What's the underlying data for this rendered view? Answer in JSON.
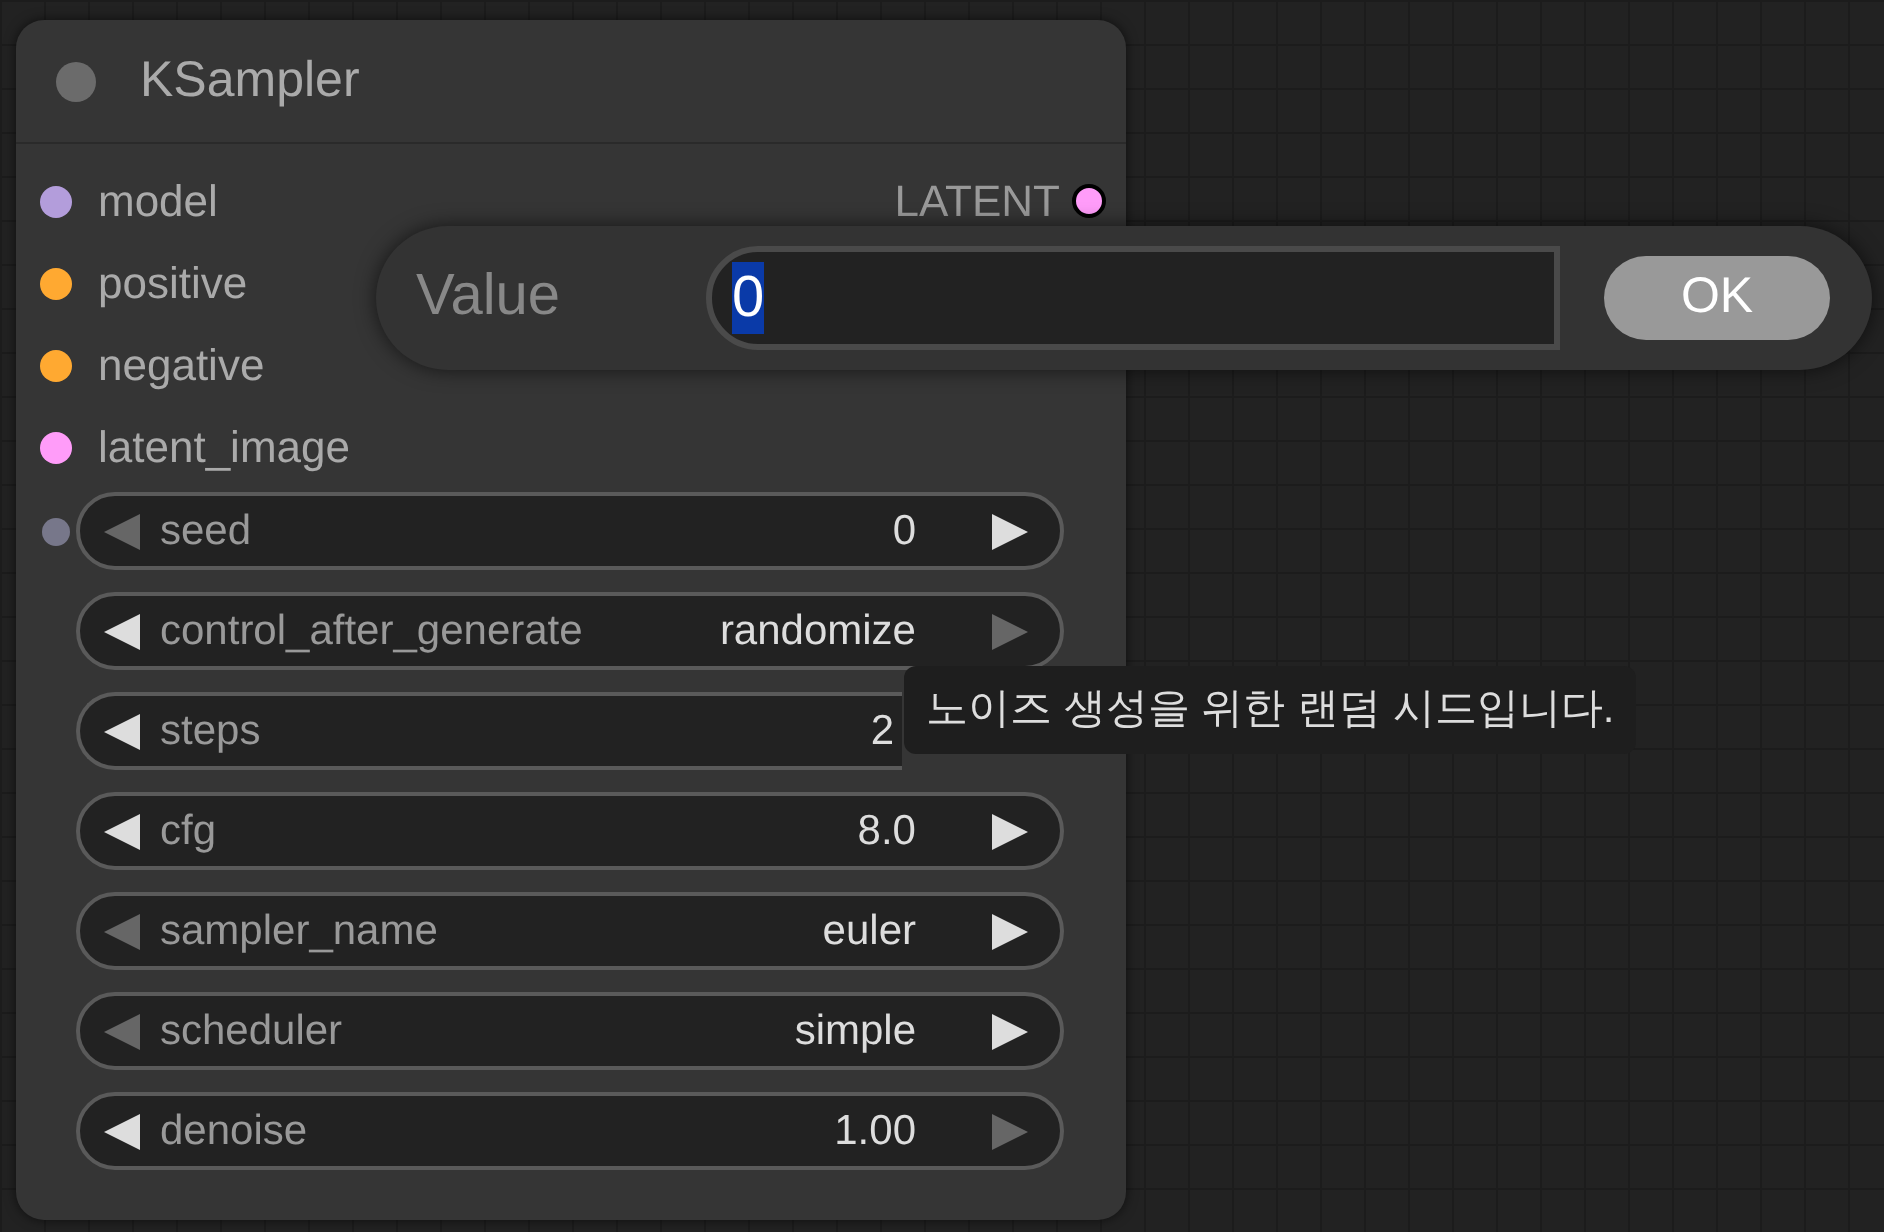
{
  "node": {
    "title": "KSampler",
    "inputs": [
      {
        "name": "model",
        "color": "#b39ddb"
      },
      {
        "name": "positive",
        "color": "#ffa931"
      },
      {
        "name": "negative",
        "color": "#ffa931"
      },
      {
        "name": "latent_image",
        "color": "#ff9cf9"
      }
    ],
    "output": {
      "name": "LATENT",
      "color": "#ff9cf9"
    },
    "widgets": [
      {
        "label": "seed",
        "value": "0",
        "left_enabled": false,
        "right_enabled": true,
        "linked": true
      },
      {
        "label": "control_after_generate",
        "value": "randomize",
        "left_enabled": true,
        "right_enabled": false,
        "linked": false
      },
      {
        "label": "steps",
        "value": "2",
        "left_enabled": true,
        "linked": false
      },
      {
        "label": "cfg",
        "value": "8.0",
        "left_enabled": true,
        "right_enabled": true,
        "linked": false
      },
      {
        "label": "sampler_name",
        "value": "euler",
        "left_enabled": false,
        "right_enabled": true,
        "linked": false
      },
      {
        "label": "scheduler",
        "value": "simple",
        "left_enabled": false,
        "right_enabled": true,
        "linked": false
      },
      {
        "label": "denoise",
        "value": "1.00",
        "left_enabled": true,
        "right_enabled": false,
        "linked": false
      }
    ]
  },
  "dialog": {
    "label": "Value",
    "value": "0",
    "button": "OK"
  },
  "tooltip": "노이즈 생성을 위한 랜덤 시드입니다."
}
